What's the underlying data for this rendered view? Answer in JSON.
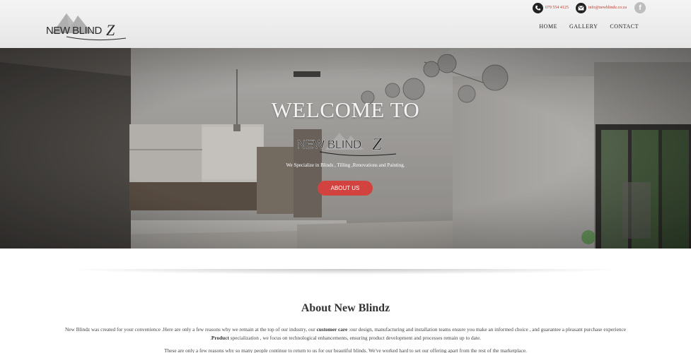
{
  "brand": {
    "name": "NEW BLINDZ"
  },
  "topbar": {
    "phone": "079 554 4125",
    "email": "info@newblindz.co.za",
    "facebook_icon": "facebook-icon"
  },
  "nav": {
    "items": [
      "HOME",
      "GALLERY",
      "CONTACT"
    ]
  },
  "hero": {
    "title": "WELCOME TO",
    "tagline": "We Specialize in Blinds , Tilling ,Renovations and Painting.",
    "button_label": "ABOUT US"
  },
  "about": {
    "title": "About New Blindz",
    "p1_a": "New  Blindz was created for your convenience .Here are only a few reasons why we remain at the top of our industry, our ",
    "p1_bold1": "customer care",
    "p1_b": " :our design, manufacturing and installation teams ensure you make an informed choice , and guarantee a pleasant purchase experience .",
    "p1_bold2": "Product",
    "p1_c": " specialization , we focus on technological enhancements, ensuring product development  and processes remain up to date.",
    "p2": "These are only a few reasons why so many people continue to return to us for our beautiful blinds. We've worked hard to set our offering apart from the rest of the marketplace."
  },
  "colors": {
    "accent": "#d2433f",
    "header_bg": "#ececec",
    "link_red": "#c0392b"
  }
}
